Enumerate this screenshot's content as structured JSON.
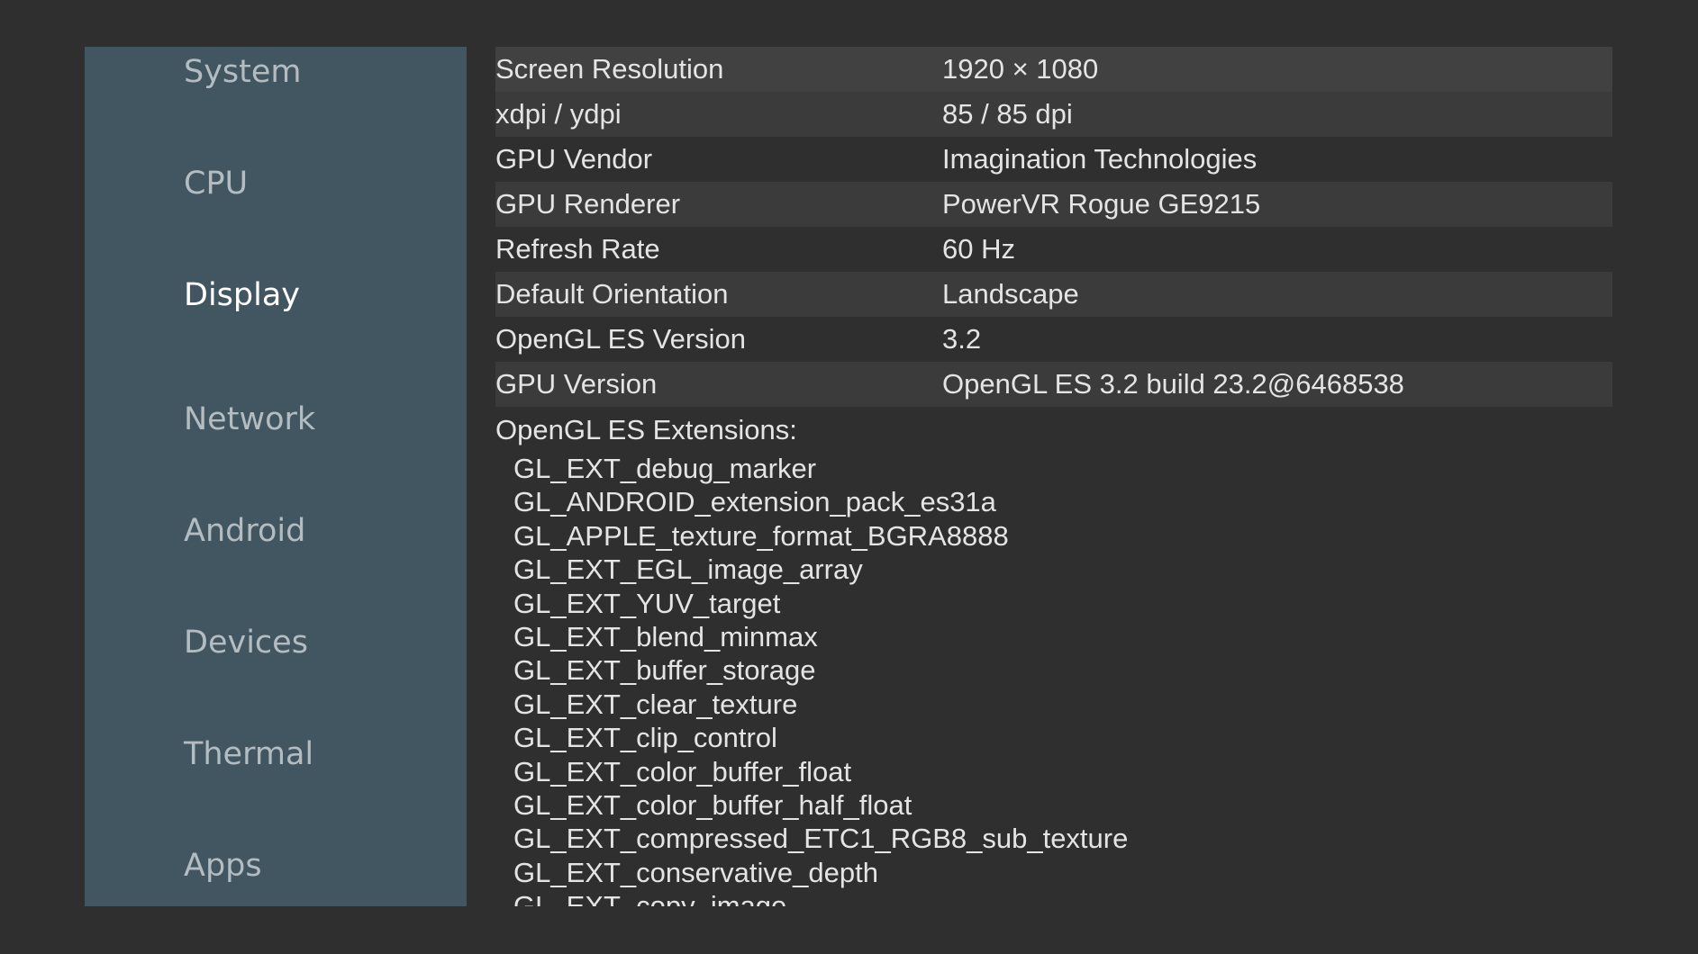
{
  "sidebar": {
    "items": [
      {
        "label": "System",
        "active": false
      },
      {
        "label": "CPU",
        "active": false
      },
      {
        "label": "Display",
        "active": true
      },
      {
        "label": "Network",
        "active": false
      },
      {
        "label": "Android",
        "active": false
      },
      {
        "label": "Devices",
        "active": false
      },
      {
        "label": "Thermal",
        "active": false
      },
      {
        "label": "Apps",
        "active": false
      }
    ]
  },
  "display_info": {
    "rows": [
      {
        "label": "Screen Resolution",
        "value": "1920 × 1080"
      },
      {
        "label": "xdpi / ydpi",
        "value": "85 / 85 dpi"
      },
      {
        "label": "GPU Vendor",
        "value": "Imagination Technologies"
      },
      {
        "label": "GPU Renderer",
        "value": "PowerVR Rogue GE9215"
      },
      {
        "label": "Refresh Rate",
        "value": "60 Hz"
      },
      {
        "label": "Default Orientation",
        "value": "Landscape"
      },
      {
        "label": "OpenGL ES Version",
        "value": "3.2"
      },
      {
        "label": "GPU Version",
        "value": "OpenGL ES 3.2 build 23.2@6468538"
      }
    ],
    "extensions_header": "OpenGL ES Extensions:",
    "extensions": [
      "GL_EXT_debug_marker",
      "GL_ANDROID_extension_pack_es31a",
      "GL_APPLE_texture_format_BGRA8888",
      "GL_EXT_EGL_image_array",
      "GL_EXT_YUV_target",
      "GL_EXT_blend_minmax",
      "GL_EXT_buffer_storage",
      "GL_EXT_clear_texture",
      "GL_EXT_clip_control",
      "GL_EXT_color_buffer_float",
      "GL_EXT_color_buffer_half_float",
      "GL_EXT_compressed_ETC1_RGB8_sub_texture",
      "GL_EXT_conservative_depth",
      "GL_EXT_copy_image"
    ]
  },
  "colors": {
    "background": "#2f2f2f",
    "sidebar": "#415661",
    "row_stripe": "#3b3b3b",
    "text": "#e4e4e4",
    "nav_inactive": "#b3bcc1",
    "nav_active": "#ffffff"
  }
}
